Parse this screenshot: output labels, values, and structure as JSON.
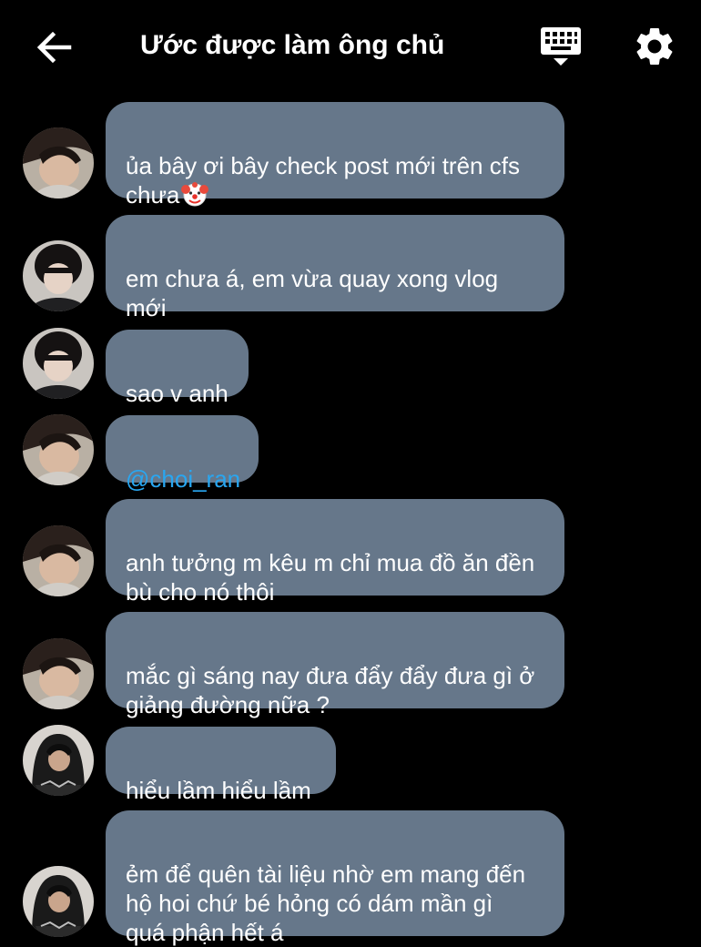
{
  "header": {
    "title": "Ước được làm ông chủ",
    "back_icon": "arrow-left-icon",
    "keyboard_icon": "keyboard-icon",
    "settings_icon": "gear-icon"
  },
  "colors": {
    "background": "#000000",
    "bubble": "#66778a",
    "text": "#ffffff",
    "mention": "#29a6f0"
  },
  "messages": [
    {
      "sender_avatar": "avatar-a",
      "text": "ủa bây ơi bây check post mới trên cfs\nchưa",
      "emoji": "clown-face"
    },
    {
      "sender_avatar": "avatar-b",
      "text": "em chưa á, em vừa quay xong vlog\nmới"
    },
    {
      "sender_avatar": "avatar-b",
      "text": "sao v anh"
    },
    {
      "sender_avatar": "avatar-a",
      "text": "@choi_ran",
      "is_mention": true
    },
    {
      "sender_avatar": "avatar-a",
      "text": "anh tưởng m kêu m chỉ mua đồ ăn đền\nbù cho nó thôi"
    },
    {
      "sender_avatar": "avatar-a",
      "text": "mắc gì sáng nay đưa đẩy đẩy đưa gì ở\ngiảng đường nữa ?"
    },
    {
      "sender_avatar": "avatar-c",
      "text": "hiểu lầm hiểu lầm"
    },
    {
      "sender_avatar": "avatar-c",
      "text": "ẻm để quên tài liệu nhờ em mang đến\nhộ hoi chứ bé hỏng có dám mần gì\nquá phận hết á"
    }
  ]
}
